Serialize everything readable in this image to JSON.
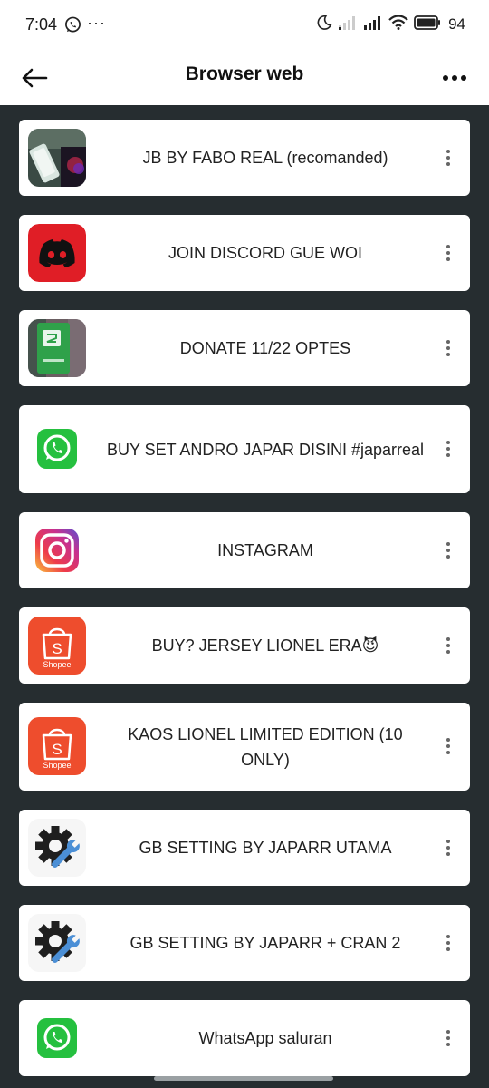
{
  "status_bar": {
    "time": "7:04",
    "notification_dots": "···",
    "battery": "94"
  },
  "app_bar": {
    "title": "Browser web",
    "back_icon": "arrow-left-icon",
    "menu_icon": "more-horizontal-icon"
  },
  "items": [
    {
      "label": "JB BY FABO REAL (recomanded)",
      "icon": "phone-photo-thumbnail"
    },
    {
      "label": "JOIN DISCORD GUE WOI",
      "icon": "discord-icon"
    },
    {
      "label": "DONATE 11/22 OPTES",
      "icon": "donate-card-thumbnail"
    },
    {
      "label": "BUY SET ANDRO JAPAR DISINI #japarreal",
      "icon": "whatsapp-icon"
    },
    {
      "label": "INSTAGRAM",
      "icon": "instagram-icon"
    },
    {
      "label": "BUY? JERSEY LIONEL ERA😈",
      "icon": "shopee-icon",
      "icon_caption": "Shopee"
    },
    {
      "label": "KAOS LIONEL LIMITED EDITION (10 ONLY)",
      "icon": "shopee-icon",
      "icon_caption": "Shopee"
    },
    {
      "label": "GB SETTING BY JAPARR UTAMA",
      "icon": "settings-wrench-icon"
    },
    {
      "label": "GB SETTING BY JAPARR + CRAN 2",
      "icon": "settings-wrench-icon"
    },
    {
      "label": "WhatsApp saluran",
      "icon": "whatsapp-icon"
    }
  ],
  "colors": {
    "background": "#262d30",
    "discord": "#e01e26",
    "whatsapp": "#25c03f",
    "shopee": "#ee4d2d"
  }
}
